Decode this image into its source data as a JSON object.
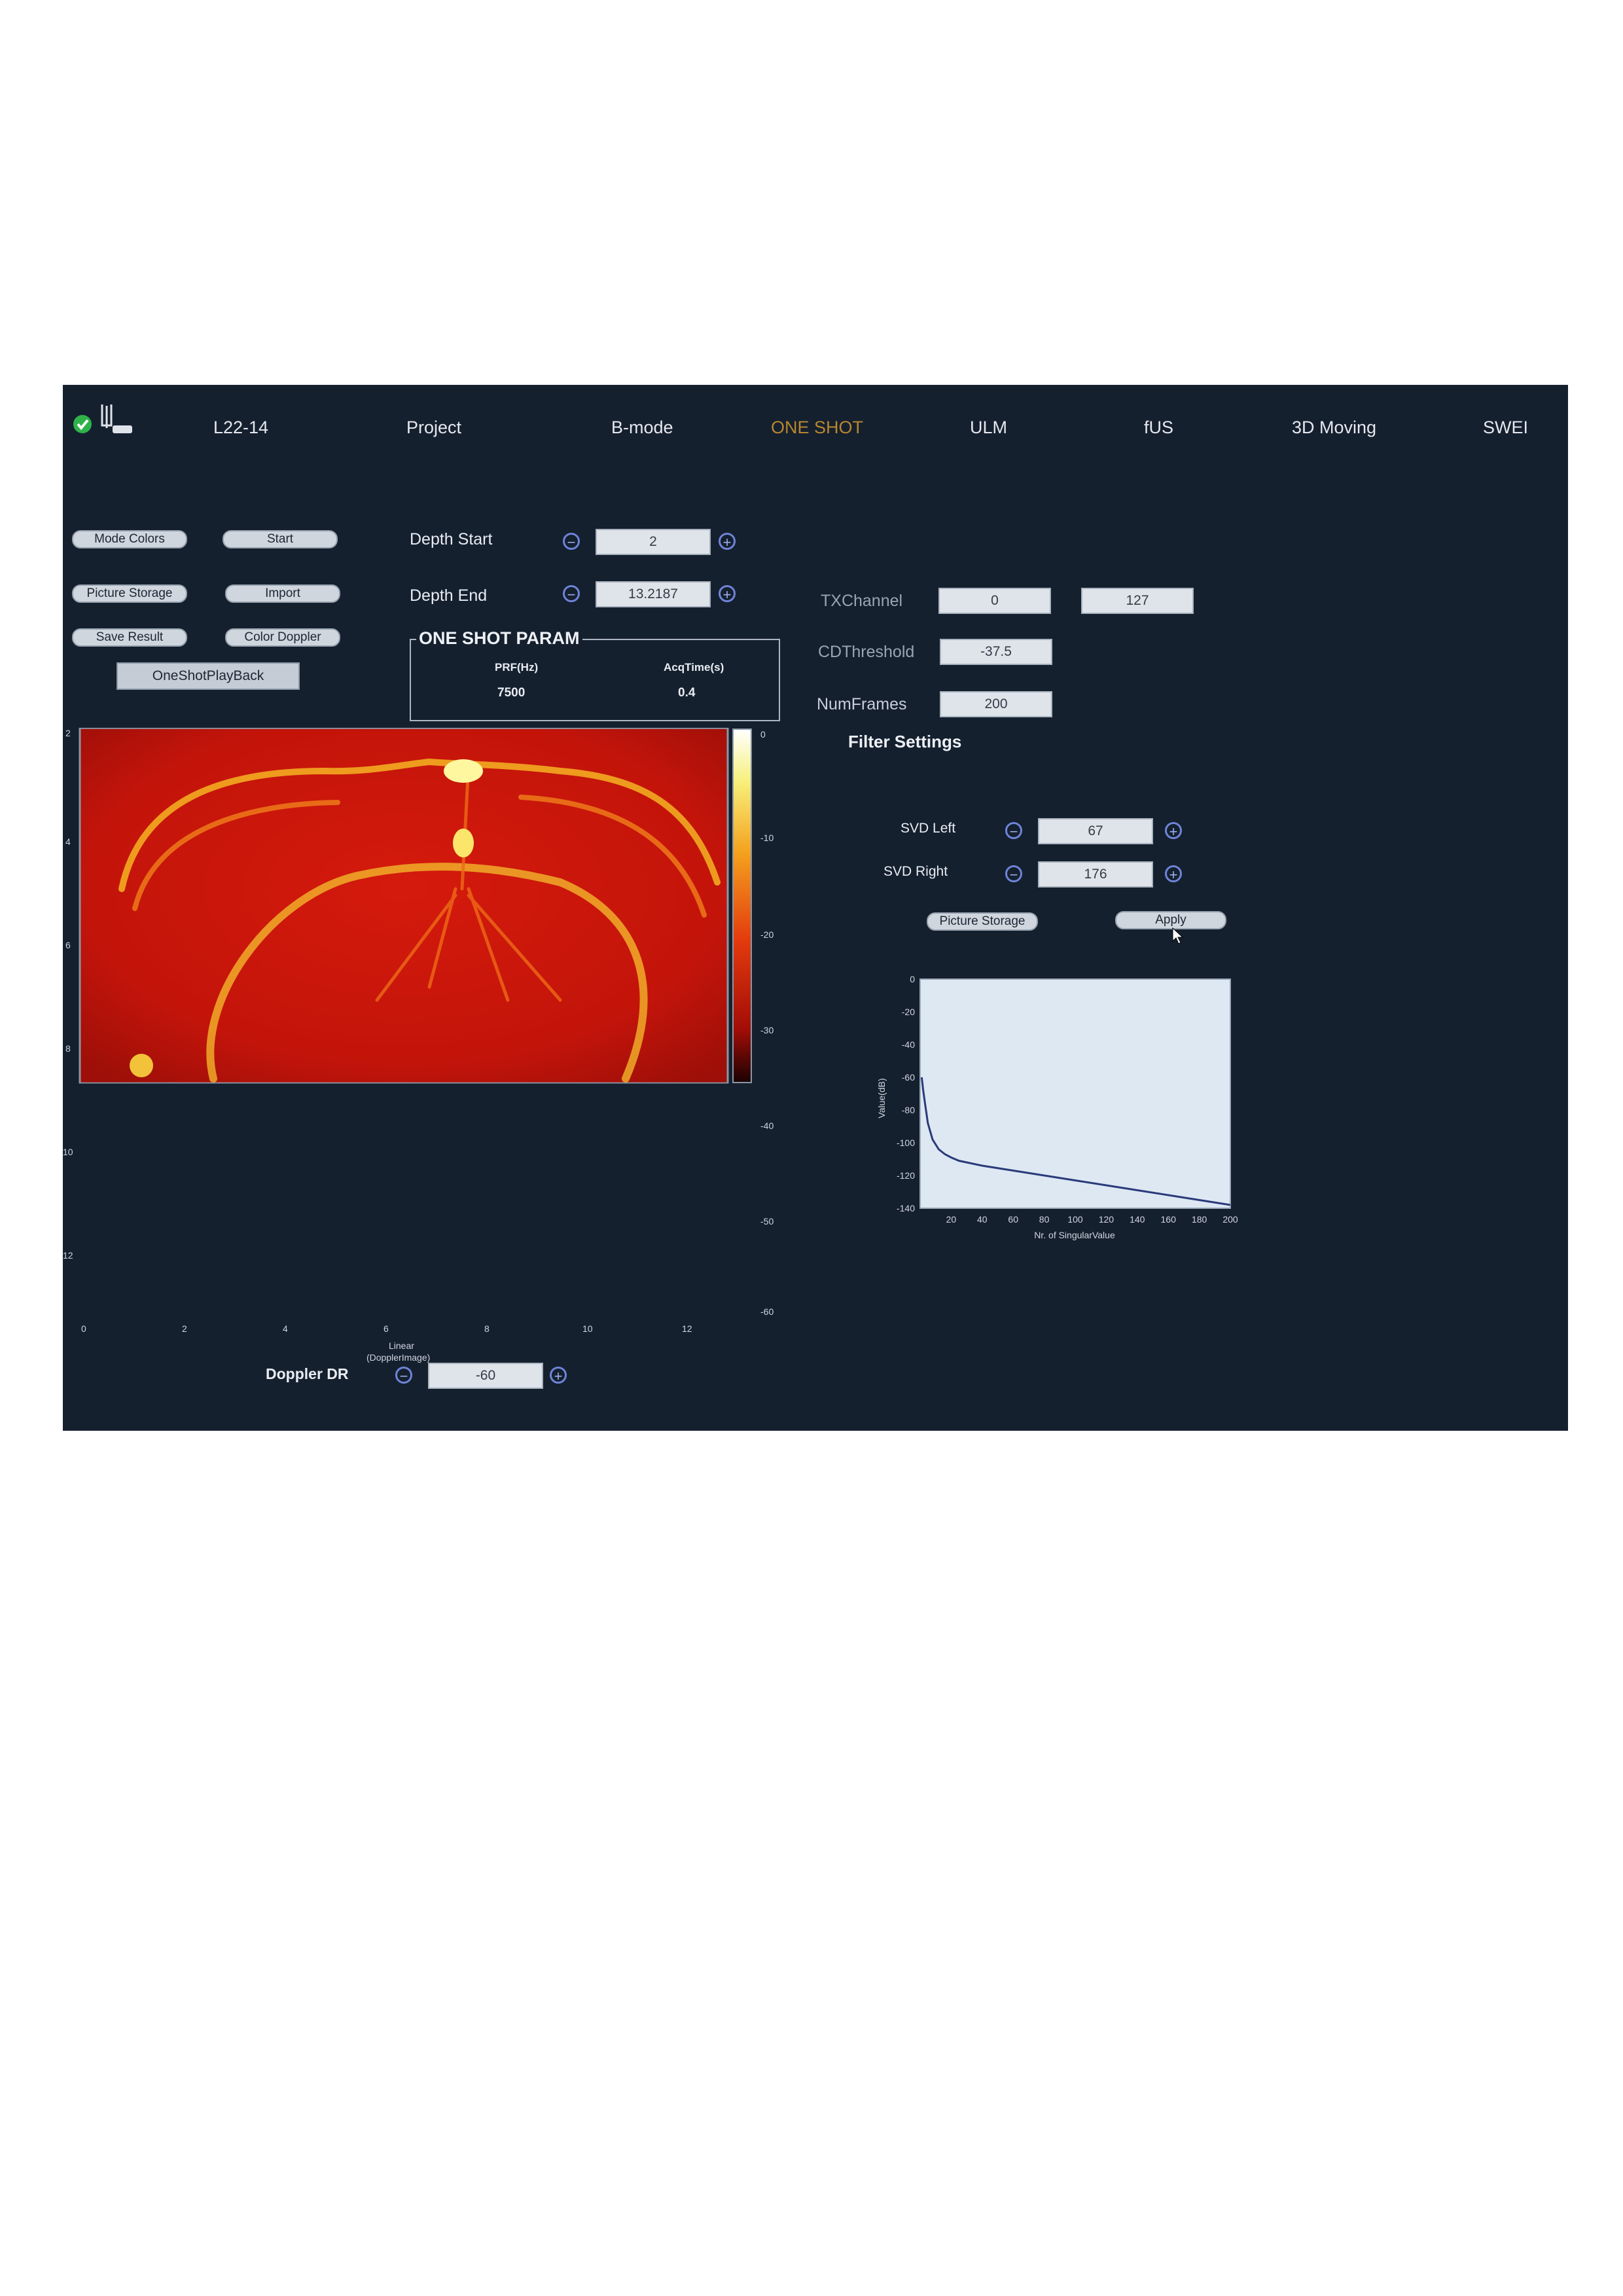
{
  "nav": {
    "probe": "L22-14",
    "tabs": [
      "Project",
      "B-mode",
      "ONE SHOT",
      "ULM",
      "fUS",
      "3D Moving",
      "SWEI"
    ],
    "active_tab": "ONE SHOT"
  },
  "left_buttons": {
    "mode_colors": "Mode Colors",
    "start": "Start",
    "picture_storage": "Picture Storage",
    "import": "Import",
    "save_result": "Save Result",
    "color_doppler": "Color Doppler",
    "oneshot_playback": "OneShotPlayBack"
  },
  "depth": {
    "start_label": "Depth Start",
    "start_value": "2",
    "end_label": "Depth End",
    "end_value": "13.2187"
  },
  "one_shot_param": {
    "title": "ONE SHOT PARAM",
    "col1_label": "PRF(Hz)",
    "col1_value": "7500",
    "col2_label": "AcqTime(s)",
    "col2_value": "0.4"
  },
  "tx": {
    "channel_label": "TXChannel",
    "channel_from": "0",
    "channel_to": "127",
    "cd_threshold_label": "CDThreshold",
    "cd_threshold": "-37.5",
    "num_frames_label": "NumFrames",
    "num_frames": "200"
  },
  "filter": {
    "title": "Filter Settings",
    "svd_left_label": "SVD Left",
    "svd_left": "67",
    "svd_right_label": "SVD Right",
    "svd_right": "176",
    "picture_storage": "Picture Storage",
    "apply": "Apply"
  },
  "doppler": {
    "label": "Doppler DR",
    "value": "-60"
  },
  "image_axes": {
    "y_ticks": [
      "2",
      "4",
      "6",
      "8",
      "10",
      "12"
    ],
    "x_ticks": [
      "0",
      "2",
      "4",
      "6",
      "8",
      "10",
      "12"
    ],
    "xlabel": "Linear",
    "xlabel2": "(DopplerImage)",
    "colorbar_ticks": [
      "0",
      "-10",
      "-20",
      "-30",
      "-40",
      "-50",
      "-60"
    ]
  },
  "chart_data": {
    "type": "line",
    "title": "",
    "xlabel": "Nr. of SingularValue",
    "ylabel": "Value(dB)",
    "xlim": [
      0,
      200
    ],
    "ylim": [
      -140,
      0
    ],
    "x_ticks": [
      "20",
      "40",
      "60",
      "80",
      "100",
      "120",
      "140",
      "160",
      "180",
      "200"
    ],
    "y_ticks": [
      "0",
      "-20",
      "-40",
      "-60",
      "-80",
      "-100",
      "-120",
      "-140"
    ],
    "series": [
      {
        "x": [
          1,
          2,
          3,
          5,
          8,
          12,
          16,
          20,
          25,
          30,
          40,
          60,
          80,
          100,
          120,
          140,
          160,
          180,
          200
        ],
        "y": [
          -60,
          -68,
          -75,
          -88,
          -98,
          -104,
          -107,
          -109,
          -111,
          -112,
          -114,
          -117,
          -120,
          -123,
          -126,
          -129,
          -132,
          -135,
          -138
        ]
      }
    ],
    "grid": false,
    "legend": false,
    "colors": {
      "line": "#2b3a7a",
      "background": "#dde8f3"
    }
  }
}
